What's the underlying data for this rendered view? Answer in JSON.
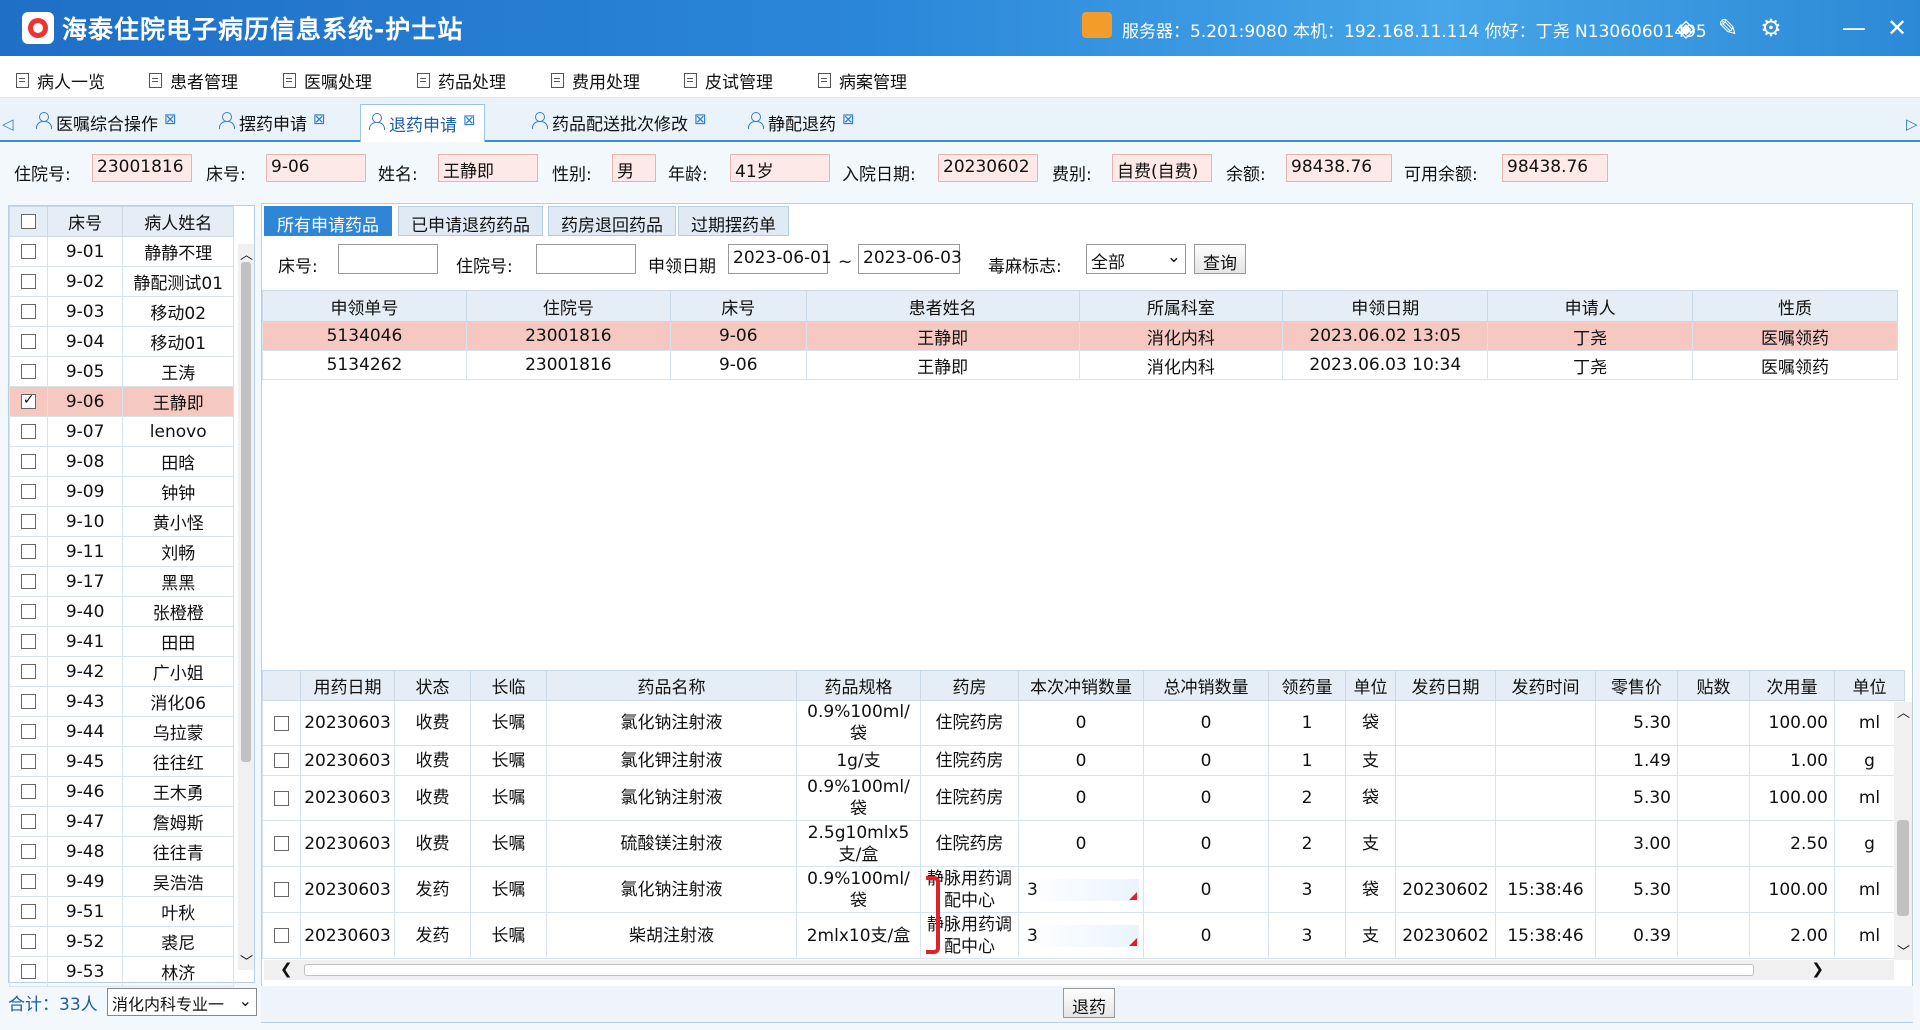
{
  "titlebar": {
    "title": "海泰住院电子病历信息系统-护士站",
    "server_info": "服务器：5.201:9080 本机：192.168.11.114 你好：丁尧 N13060601495"
  },
  "menu": [
    "病人一览",
    "患者管理",
    "医嘱处理",
    "药品处理",
    "费用处理",
    "皮试管理",
    "病案管理"
  ],
  "tabs": [
    {
      "label": "医嘱综合操作",
      "active": false
    },
    {
      "label": "摆药申请",
      "active": false
    },
    {
      "label": "退药申请",
      "active": true
    },
    {
      "label": "药品配送批次修改",
      "active": false
    },
    {
      "label": "静配退药",
      "active": false
    }
  ],
  "patient_info": {
    "admission_no_label": "住院号:",
    "admission_no": "23001816",
    "bed_label": "床号:",
    "bed": "9-06",
    "name_label": "姓名:",
    "name": "王静即",
    "gender_label": "性别:",
    "gender": "男",
    "age_label": "年龄:",
    "age": "41岁",
    "admit_date_label": "入院日期:",
    "admit_date": "20230602",
    "fee_type_label": "费别:",
    "fee_type": "自费(自费)",
    "balance_label": "余额:",
    "balance": "98438.76",
    "available_label": "可用余额:",
    "available": "98438.76"
  },
  "patient_list": {
    "headers": [
      "床号",
      "病人姓名"
    ],
    "rows": [
      {
        "bed": "9-01",
        "name": "静静不理",
        "checked": false
      },
      {
        "bed": "9-02",
        "name": "静配测试01",
        "checked": false
      },
      {
        "bed": "9-03",
        "name": "移动02",
        "checked": false
      },
      {
        "bed": "9-04",
        "name": "移动01",
        "checked": false
      },
      {
        "bed": "9-05",
        "name": "王涛",
        "checked": false
      },
      {
        "bed": "9-06",
        "name": "王静即",
        "checked": true
      },
      {
        "bed": "9-07",
        "name": "lenovo",
        "checked": false
      },
      {
        "bed": "9-08",
        "name": "田晗",
        "checked": false
      },
      {
        "bed": "9-09",
        "name": "钟钟",
        "checked": false
      },
      {
        "bed": "9-10",
        "name": "黄小怪",
        "checked": false
      },
      {
        "bed": "9-11",
        "name": "刘畅",
        "checked": false
      },
      {
        "bed": "9-17",
        "name": "黑黑",
        "checked": false
      },
      {
        "bed": "9-40",
        "name": "张橙橙",
        "checked": false
      },
      {
        "bed": "9-41",
        "name": "田田",
        "checked": false
      },
      {
        "bed": "9-42",
        "name": "广小姐",
        "checked": false
      },
      {
        "bed": "9-43",
        "name": "消化06",
        "checked": false
      },
      {
        "bed": "9-44",
        "name": "乌拉蒙",
        "checked": false
      },
      {
        "bed": "9-45",
        "name": "往往红",
        "checked": false
      },
      {
        "bed": "9-46",
        "name": "王木勇",
        "checked": false
      },
      {
        "bed": "9-47",
        "name": "詹姆斯",
        "checked": false
      },
      {
        "bed": "9-48",
        "name": "往往青",
        "checked": false
      },
      {
        "bed": "9-49",
        "name": "吴浩浩",
        "checked": false
      },
      {
        "bed": "9-51",
        "name": "叶秋",
        "checked": false
      },
      {
        "bed": "9-52",
        "name": "裘尼",
        "checked": false
      },
      {
        "bed": "9-53",
        "name": "林济",
        "checked": false
      }
    ],
    "total_label": "合计：33人",
    "dept_selected": "消化内科专业一"
  },
  "subtabs": [
    {
      "label": "所有申请药品",
      "active": true
    },
    {
      "label": "已申请退药药品",
      "active": false
    },
    {
      "label": "药房退回药品",
      "active": false
    },
    {
      "label": "过期摆药单",
      "active": false
    }
  ],
  "filters": {
    "bed_label": "床号:",
    "bed_value": "",
    "admission_label": "住院号:",
    "admission_value": "",
    "date_label": "申领日期",
    "date_from": "2023-06-01",
    "date_sep": "~",
    "date_to": "2023-06-03",
    "toxic_label": "毒麻标志:",
    "toxic_value": "全部",
    "query_button": "查询"
  },
  "requests": {
    "headers": [
      "申领单号",
      "住院号",
      "床号",
      "患者姓名",
      "所属科室",
      "申领日期",
      "申请人",
      "性质"
    ],
    "rows": [
      [
        "5134046",
        "23001816",
        "9-06",
        "王静即",
        "消化内科",
        "2023.06.02 13:05",
        "丁尧",
        "医嘱领药"
      ],
      [
        "5134262",
        "23001816",
        "9-06",
        "王静即",
        "消化内科",
        "2023.06.03 10:34",
        "丁尧",
        "医嘱领药"
      ]
    ]
  },
  "medications": {
    "headers": [
      "",
      "用药日期",
      "状态",
      "长临",
      "药品名称",
      "药品规格",
      "药房",
      "本次冲销数量",
      "总冲销数量",
      "领药量",
      "单位",
      "发药日期",
      "发药时间",
      "零售价",
      "贴数",
      "次用量",
      "单位"
    ],
    "rows": [
      [
        "20230603",
        "收费",
        "长嘱",
        "氯化钠注射液",
        "0.9%100ml/袋",
        "住院药房",
        "0",
        "0",
        "1",
        "袋",
        "",
        "",
        "5.30",
        "",
        "100.00",
        "ml"
      ],
      [
        "20230603",
        "收费",
        "长嘱",
        "氯化钾注射液",
        "1g/支",
        "住院药房",
        "0",
        "0",
        "1",
        "支",
        "",
        "",
        "1.49",
        "",
        "1.00",
        "g"
      ],
      [
        "20230603",
        "收费",
        "长嘱",
        "氯化钠注射液",
        "0.9%100ml/袋",
        "住院药房",
        "0",
        "0",
        "2",
        "袋",
        "",
        "",
        "5.30",
        "",
        "100.00",
        "ml"
      ],
      [
        "20230603",
        "收费",
        "长嘱",
        "硫酸镁注射液",
        "2.5g10mlx5支/盒",
        "住院药房",
        "0",
        "0",
        "2",
        "支",
        "",
        "",
        "3.00",
        "",
        "2.50",
        "g"
      ],
      [
        "20230603",
        "发药",
        "长嘱",
        "氯化钠注射液",
        "0.9%100ml/袋",
        "静脉用药调配中心",
        "3",
        "0",
        "3",
        "袋",
        "20230602",
        "15:38:46",
        "5.30",
        "",
        "100.00",
        "ml"
      ],
      [
        "20230603",
        "发药",
        "长嘱",
        "柴胡注射液",
        "2mlx10支/盒",
        "静脉用药调配中心",
        "3",
        "0",
        "3",
        "支",
        "20230602",
        "15:38:46",
        "0.39",
        "",
        "2.00",
        "ml"
      ]
    ]
  },
  "return_button": "退药"
}
